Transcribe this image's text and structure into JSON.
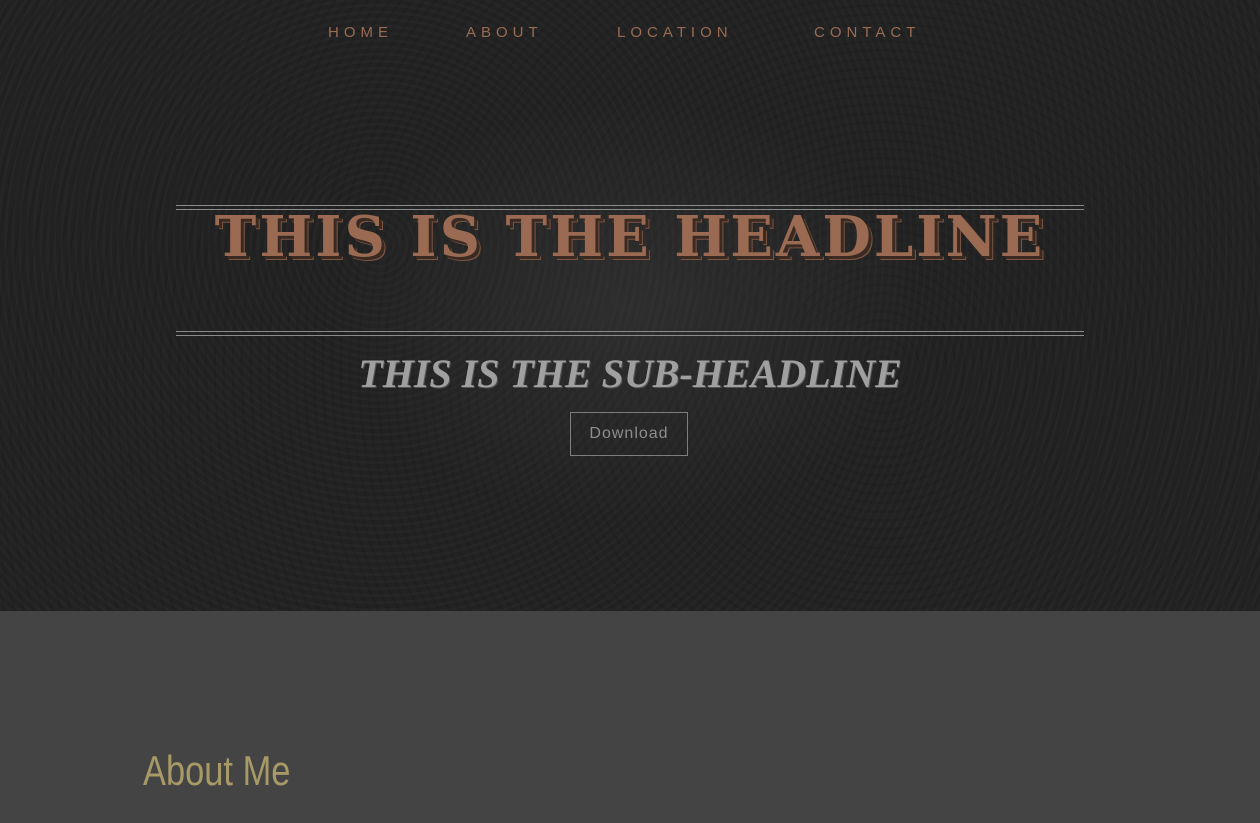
{
  "nav": {
    "items": [
      {
        "label": "HOME"
      },
      {
        "label": "ABOUT"
      },
      {
        "label": "LOCATION"
      },
      {
        "label": "CONTACT"
      }
    ]
  },
  "hero": {
    "headline": "THIS IS THE HEADLINE",
    "subheadline": "THIS IS THE SUB-HEADLINE",
    "button_label": "Download"
  },
  "about": {
    "title": "About Me"
  },
  "colors": {
    "hero_background": "#222222",
    "section_background": "#444444",
    "accent_copper": "#9a6b52",
    "subheadline_gray": "#a0a0a0",
    "about_title": "#a89a66"
  }
}
